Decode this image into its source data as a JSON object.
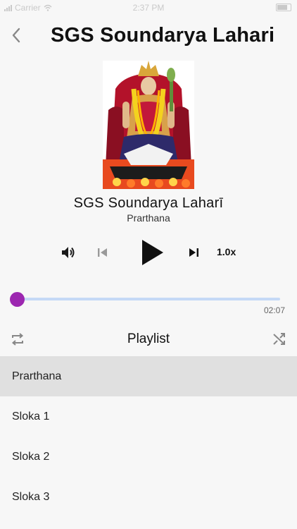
{
  "status_bar": {
    "carrier": "Carrier",
    "time": "2:37 PM"
  },
  "header": {
    "title": "SGS Soundarya Lahari",
    "back_icon": "chevron-left-icon"
  },
  "track": {
    "title": "SGS Soundarya Laharī",
    "subtitle": "Prarthana"
  },
  "controls": {
    "volume_icon": "volume-icon",
    "previous_icon": "skip-previous-icon",
    "play_icon": "play-icon",
    "next_icon": "skip-next-icon",
    "speed": "1.0x"
  },
  "progress": {
    "duration": "02:07",
    "position_fraction": 0.0
  },
  "playlist": {
    "title": "Playlist",
    "repeat_icon": "repeat-icon",
    "shuffle_icon": "shuffle-icon",
    "items": [
      {
        "label": "Prarthana",
        "active": true
      },
      {
        "label": "Sloka 1",
        "active": false
      },
      {
        "label": "Sloka 2",
        "active": false
      },
      {
        "label": "Sloka 3",
        "active": false
      }
    ]
  },
  "colors": {
    "accent": "#9c27b0",
    "progress_track": "#c5d9f6",
    "active_row": "#e0e0e0"
  }
}
